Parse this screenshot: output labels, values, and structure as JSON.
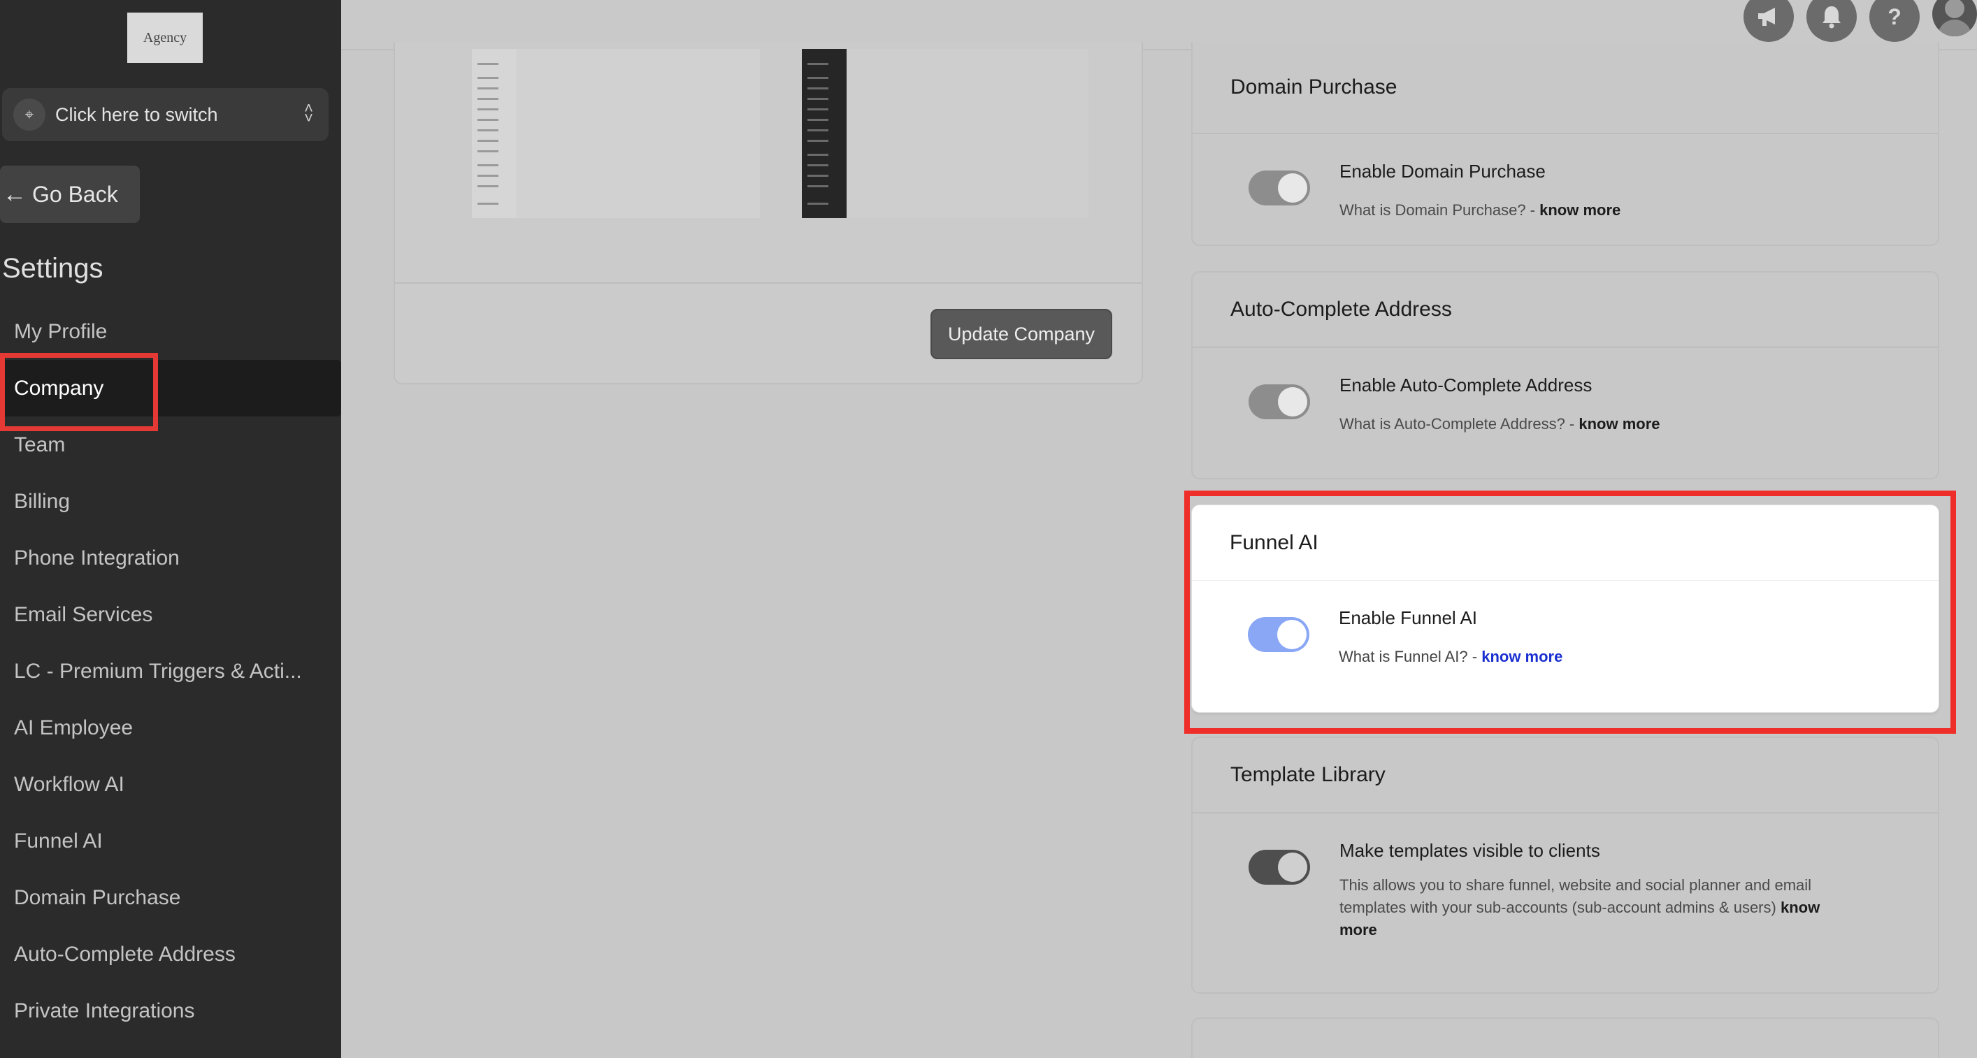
{
  "logo": {
    "text": "Agency"
  },
  "switcher": {
    "label": "Click here to switch"
  },
  "go_back": {
    "label": "Go Back"
  },
  "settings_title": "Settings",
  "sidebar": {
    "items": [
      {
        "label": "My Profile",
        "active": false
      },
      {
        "label": "Company",
        "active": true
      },
      {
        "label": "Team",
        "active": false
      },
      {
        "label": "Billing",
        "active": false
      },
      {
        "label": "Phone Integration",
        "active": false
      },
      {
        "label": "Email Services",
        "active": false
      },
      {
        "label": "LC - Premium Triggers & Acti...",
        "active": false
      },
      {
        "label": "AI Employee",
        "active": false
      },
      {
        "label": "Workflow AI",
        "active": false
      },
      {
        "label": "Funnel AI",
        "active": false
      },
      {
        "label": "Domain Purchase",
        "active": false
      },
      {
        "label": "Auto-Complete Address",
        "active": false
      },
      {
        "label": "Private Integrations",
        "active": false
      }
    ]
  },
  "topbar": {
    "icons": [
      "megaphone-icon",
      "bell-icon",
      "help-icon",
      "avatar"
    ]
  },
  "company_card": {
    "update_label": "Update Company"
  },
  "cards": {
    "domain": {
      "title": "Domain Purchase",
      "option": "Enable Domain Purchase",
      "desc": "What is Domain Purchase? - ",
      "link": "know more",
      "enabled": true
    },
    "address": {
      "title": "Auto-Complete Address",
      "option": "Enable Auto-Complete Address",
      "desc": "What is Auto-Complete Address? - ",
      "link": "know more",
      "enabled": true
    },
    "funnel": {
      "title": "Funnel AI",
      "option": "Enable Funnel AI",
      "desc": "What is Funnel AI? - ",
      "link": "know more",
      "enabled": true
    },
    "template": {
      "title": "Template Library",
      "option": "Make templates visible to clients",
      "desc": "This allows you to share funnel, website and social planner and email templates with your sub-accounts (sub-account admins & users) ",
      "link": "know more",
      "enabled": true
    }
  },
  "colors": {
    "highlight": "#ef2e2a",
    "toggle_on": "#8aa7f5",
    "link": "#1a2fd0"
  }
}
